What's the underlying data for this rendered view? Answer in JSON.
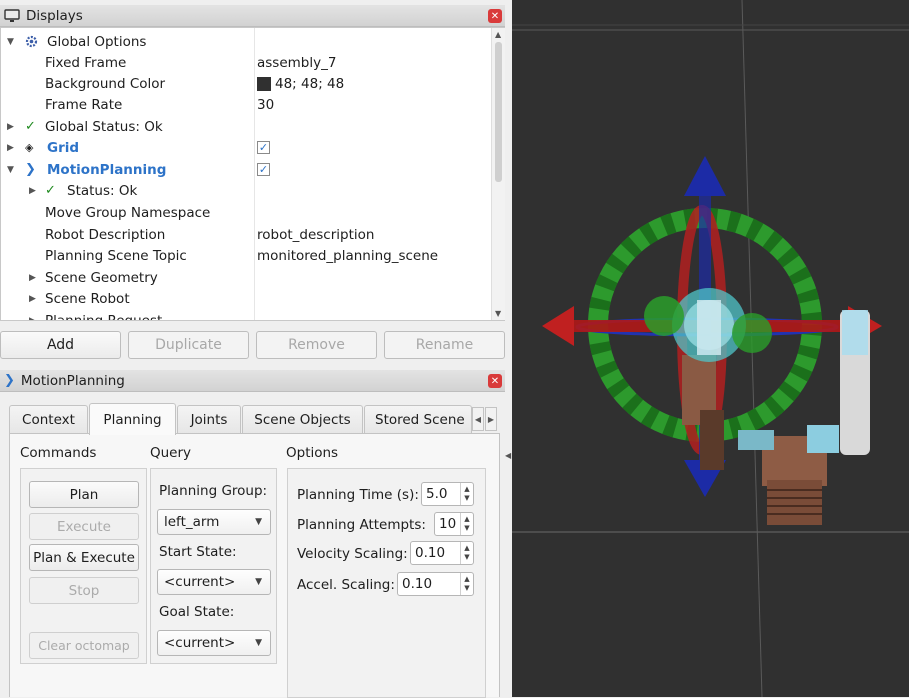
{
  "displays_panel": {
    "title": "Displays",
    "tree": {
      "global_options": "Global Options",
      "fixed_frame_label": "Fixed Frame",
      "fixed_frame_value": "assembly_7",
      "background_color_label": "Background Color",
      "background_color_value": "48; 48; 48",
      "background_color_hex": "#303030",
      "frame_rate_label": "Frame Rate",
      "frame_rate_value": "30",
      "global_status": "Global Status: Ok",
      "grid": "Grid",
      "grid_checked": "✓",
      "motion_planning": "MotionPlanning",
      "motion_planning_checked": "✓",
      "status": "Status: Ok",
      "move_group_namespace": "Move Group Namespace",
      "robot_description_label": "Robot Description",
      "robot_description_value": "robot_description",
      "planning_scene_topic_label": "Planning Scene Topic",
      "planning_scene_topic_value": "monitored_planning_scene",
      "scene_geometry": "Scene Geometry",
      "scene_robot": "Scene Robot",
      "planning_request": "Planning Request"
    },
    "buttons": {
      "add": "Add",
      "duplicate": "Duplicate",
      "remove": "Remove",
      "rename": "Rename"
    }
  },
  "motion_panel": {
    "title": "MotionPlanning",
    "tabs": [
      "Context",
      "Planning",
      "Joints",
      "Scene Objects",
      "Stored Scene"
    ],
    "active_tab": "Planning",
    "commands": {
      "label": "Commands",
      "plan": "Plan",
      "execute": "Execute",
      "plan_execute": "Plan & Execute",
      "stop": "Stop",
      "clear_octomap": "Clear octomap"
    },
    "query": {
      "label": "Query",
      "planning_group_label": "Planning Group:",
      "planning_group_value": "left_arm",
      "start_state_label": "Start State:",
      "start_state_value": "<current>",
      "goal_state_label": "Goal State:",
      "goal_state_value": "<current>"
    },
    "options": {
      "label": "Options",
      "planning_time_label": "Planning Time (s):",
      "planning_time_value": "5.0",
      "planning_attempts_label": "Planning Attempts:",
      "planning_attempts_value": "10",
      "velocity_scaling_label": "Velocity Scaling:",
      "velocity_scaling_value": "0.10",
      "accel_scaling_label": "Accel. Scaling:",
      "accel_scaling_value": "0.10"
    }
  },
  "colors": {
    "viewport_bg": "#303030",
    "accent_blue": "#2d73c8",
    "close_red": "#d93a3a",
    "status_green": "#1f8a1f"
  }
}
